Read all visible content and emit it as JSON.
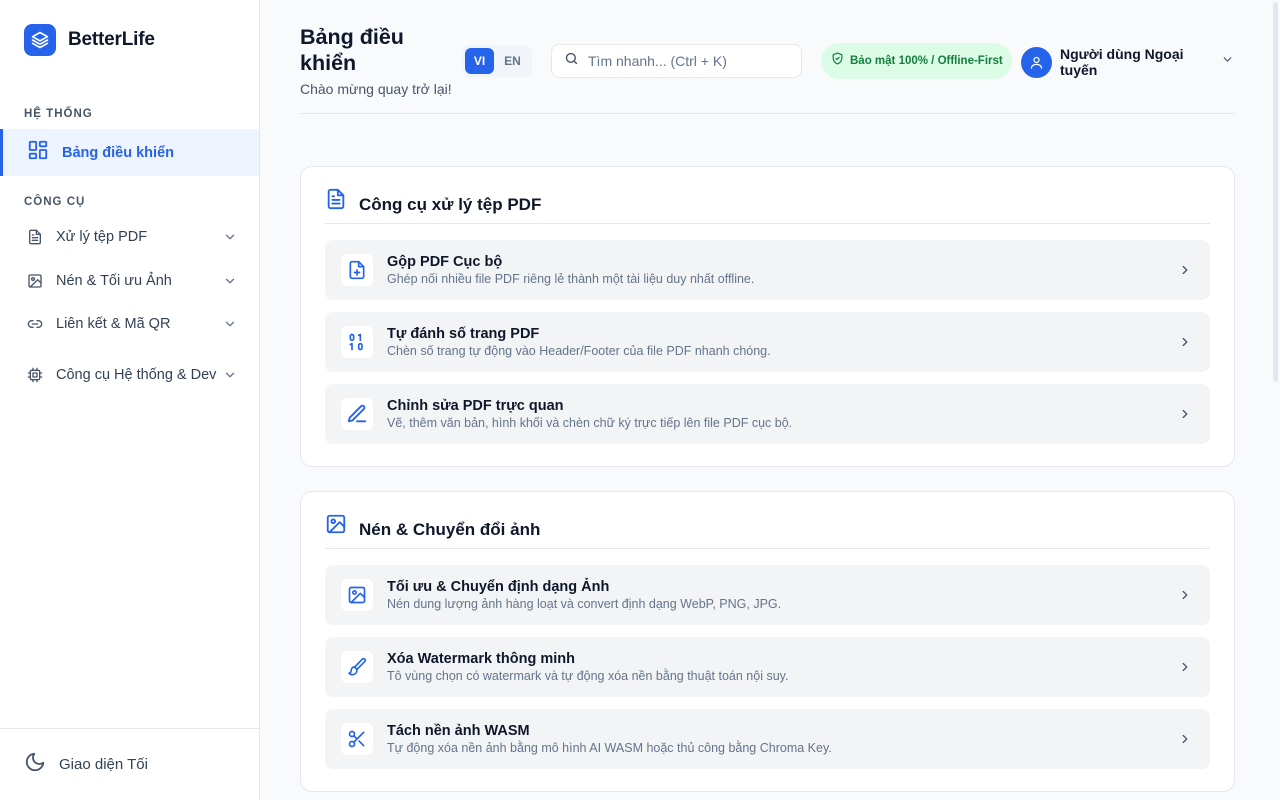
{
  "brand": {
    "name": "BetterLife"
  },
  "sidebar": {
    "section_system": "HỆ THỐNG",
    "dashboard_label": "Bảng điều khiển",
    "section_tools": "CÔNG CỤ",
    "items": [
      {
        "label": "Xử lý tệp PDF",
        "icon": "file-text-icon"
      },
      {
        "label": "Nén & Tối ưu Ảnh",
        "icon": "image-icon"
      },
      {
        "label": "Liên kết & Mã QR",
        "icon": "link-icon"
      },
      {
        "label": "Công cụ Hệ thống & Dev",
        "icon": "chip-icon"
      }
    ],
    "theme_toggle_label": "Giao diện Tối"
  },
  "header": {
    "title": "Bảng điều khiển",
    "subtitle": "Chào mừng quay trở lại!",
    "lang_vi": "VI",
    "lang_en": "EN",
    "active_lang": "VI",
    "search_placeholder": "Tìm nhanh... (Ctrl + K)",
    "security_badge": "Bảo mật 100% / Offline-First",
    "user_name": "Người dùng Ngoại tuyến"
  },
  "cards": [
    {
      "title": "Công cụ xử lý tệp PDF",
      "icon": "file-text-icon",
      "tools": [
        {
          "name": "Gộp PDF Cục bộ",
          "desc": "Ghép nối nhiều file PDF riêng lẻ thành một tài liệu duy nhất offline.",
          "icon": "file-plus-icon"
        },
        {
          "name": "Tự đánh số trang PDF",
          "desc": "Chèn số trang tự động vào Header/Footer của file PDF nhanh chóng.",
          "icon": "binary-icon"
        },
        {
          "name": "Chỉnh sửa PDF trực quan",
          "desc": "Vẽ, thêm văn bản, hình khối và chèn chữ ký trực tiếp lên file PDF cục bộ.",
          "icon": "pen-line-icon"
        }
      ]
    },
    {
      "title": "Nén & Chuyển đổi ảnh",
      "icon": "image-icon",
      "tools": [
        {
          "name": "Tối ưu & Chuyển định dạng Ảnh",
          "desc": "Nén dung lượng ảnh hàng loạt và convert định dạng WebP, PNG, JPG.",
          "icon": "image-icon"
        },
        {
          "name": "Xóa Watermark thông minh",
          "desc": "Tô vùng chọn có watermark và tự động xóa nền bằng thuật toán nội suy.",
          "icon": "brush-icon"
        },
        {
          "name": "Tách nền ảnh WASM",
          "desc": "Tự động xóa nền ảnh bằng mô hình AI WASM hoặc thủ công bằng Chroma Key.",
          "icon": "scissors-icon"
        }
      ]
    }
  ],
  "colors": {
    "accent": "#2563eb",
    "active_bg": "#eef4ff",
    "badge_bg": "#dcfce7",
    "badge_text": "#15803d",
    "tool_bg": "#f3f4f6"
  }
}
